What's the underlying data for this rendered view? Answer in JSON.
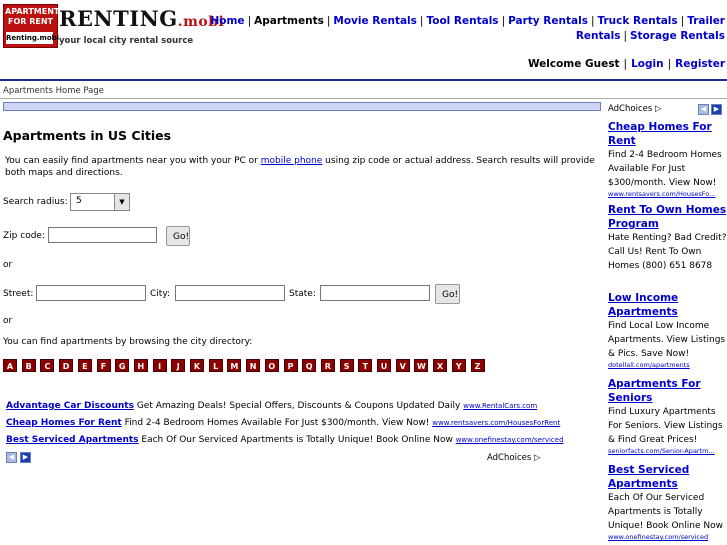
{
  "header": {
    "logo": {
      "top_line": "APARTMENT FOR RENT",
      "badge": "Renting.mobi",
      "word": "RENTING",
      "tld": ".mobi",
      "tagline": "your local  city rental source"
    },
    "nav": [
      {
        "label": "Home",
        "current": false
      },
      {
        "label": "Apartments",
        "current": true
      },
      {
        "label": "Movie Rentals",
        "current": false
      },
      {
        "label": "Tool Rentals",
        "current": false
      },
      {
        "label": "Party Rentals",
        "current": false
      },
      {
        "label": "Truck Rentals",
        "current": false
      },
      {
        "label": "Trailer Rentals",
        "current": false
      },
      {
        "label": "Storage Rentals",
        "current": false
      }
    ],
    "nav_sep": "|",
    "welcome": "Welcome Guest",
    "login": "Login",
    "register": "Register"
  },
  "breadcrumb": "Apartments Home Page",
  "main": {
    "title": "Apartments in US Cities",
    "intro_before": "You can easily find apartments near you with your PC or ",
    "intro_link": "mobile phone",
    "intro_after": " using zip code or actual address. Search results will provide both maps and directions.",
    "radius_label": "Search radius:",
    "radius_value": "5",
    "zip_label": "Zip code:",
    "go": "Go!",
    "or": "or",
    "street_label": "Street:",
    "city_label": "City:",
    "state_label": "State:",
    "browse_text": "You can find apartments by browsing the city directory:",
    "letters": [
      "A",
      "B",
      "C",
      "D",
      "E",
      "F",
      "G",
      "H",
      "I",
      "J",
      "K",
      "L",
      "M",
      "N",
      "O",
      "P",
      "Q",
      "R",
      "S",
      "T",
      "U",
      "V",
      "W",
      "X",
      "Y",
      "Z"
    ]
  },
  "ads_bottom": [
    {
      "title": "Advantage Car Discounts",
      "desc": " Get Amazing Deals! Special Offers, Discounts & Coupons Updated Daily ",
      "url": "www.RentalCars.com"
    },
    {
      "title": "Cheap Homes For Rent",
      "desc": " Find 2-4 Bedroom Homes Available For Just $300/month. View Now! ",
      "url": "www.rentsavers.com/HousesForRent"
    },
    {
      "title": "Best Serviced Apartments",
      "desc": " Each Of Our Serviced Apartments is Totally Unique! Book Online Now ",
      "url": "www.onefinestay.com/serviced"
    }
  ],
  "adchoices": "AdChoices",
  "sidebar": {
    "ads": [
      {
        "title": "Cheap Homes For Rent",
        "desc": "Find 2-4 Bedroom Homes Available For Just $300/month. View Now!",
        "url": "www.rentsavers.com/HousesFo..."
      },
      {
        "title": "Rent To Own Homes Program",
        "desc": "Hate Renting? Bad Credit? Call Us! Rent To Own Homes (800) 651 8678",
        "url": ""
      },
      {
        "title": "Low Income Apartments",
        "desc": "Find Local Low Income Apartments. View Listings & Pics. Save Now!",
        "url": "dotellall.com/apartments"
      },
      {
        "title": "Apartments For Seniors",
        "desc": "Find Luxury Apartments For Seniors. View Listings & Find Great Prices!",
        "url": "seniorfacts.com/Senior-Apartm..."
      },
      {
        "title": "Best Serviced Apartments",
        "desc": "Each Of Our Serviced Apartments is Totally Unique! Book Online Now",
        "url": "www.onefinestay.com/serviced"
      }
    ]
  },
  "colors": {
    "brand_red": "#b11111",
    "link_blue": "#0000cc",
    "rule_blue": "#1a2f8c",
    "letter_bg": "#8b0000"
  }
}
